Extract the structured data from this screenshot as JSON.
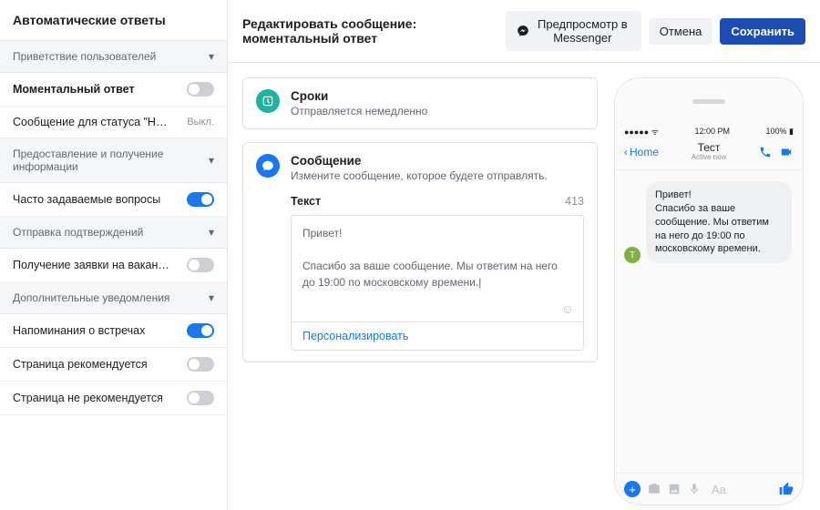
{
  "sidebar": {
    "title": "Автоматические ответы",
    "sections": [
      {
        "label": "Приветствие пользователей"
      },
      {
        "label": "Предоставление и получение информации"
      },
      {
        "label": "Отправка подтверждений"
      },
      {
        "label": "Дополнительные уведомления"
      }
    ],
    "items": {
      "instant": {
        "label": "Моментальный ответ"
      },
      "away": {
        "label": "Сообщение для статуса \"Нет на ме...",
        "status": "Выкл."
      },
      "faq": {
        "label": "Часто задаваемые вопросы"
      },
      "job": {
        "label": "Получение заявки на вакансию"
      },
      "remind": {
        "label": "Напоминания о встречах"
      },
      "rec_yes": {
        "label": "Страница рекомендуется"
      },
      "rec_no": {
        "label": "Страница не рекомендуется"
      }
    }
  },
  "topbar": {
    "title": "Редактировать сообщение: моментальный ответ",
    "preview": "Предпросмотр в Messenger",
    "cancel": "Отмена",
    "save": "Сохранить"
  },
  "editor": {
    "timing": {
      "title": "Сроки",
      "sub": "Отправляется немедленно"
    },
    "message": {
      "title": "Сообщение",
      "sub": "Измените сообщение, которое будете отправлять.",
      "text_label": "Текст",
      "count": "413",
      "text": "Привет!\n\nСпасибо за ваше сообщение. Мы ответим на него до 19:00 по московскому времени.|",
      "personalize": "Персонализировать"
    }
  },
  "preview": {
    "status": {
      "signal": "●●●●● ⁠ᯤ",
      "time": "12:00 PM",
      "battery": "100%  ▮"
    },
    "back": "Home",
    "name": "Тест",
    "sub": "Active now",
    "avatar_letter": "T",
    "bubble": "Привет!\nСпасибо за ваше сообщение. Мы ответим на него до 19:00 по московскому времени.",
    "placeholder": "Aa"
  }
}
